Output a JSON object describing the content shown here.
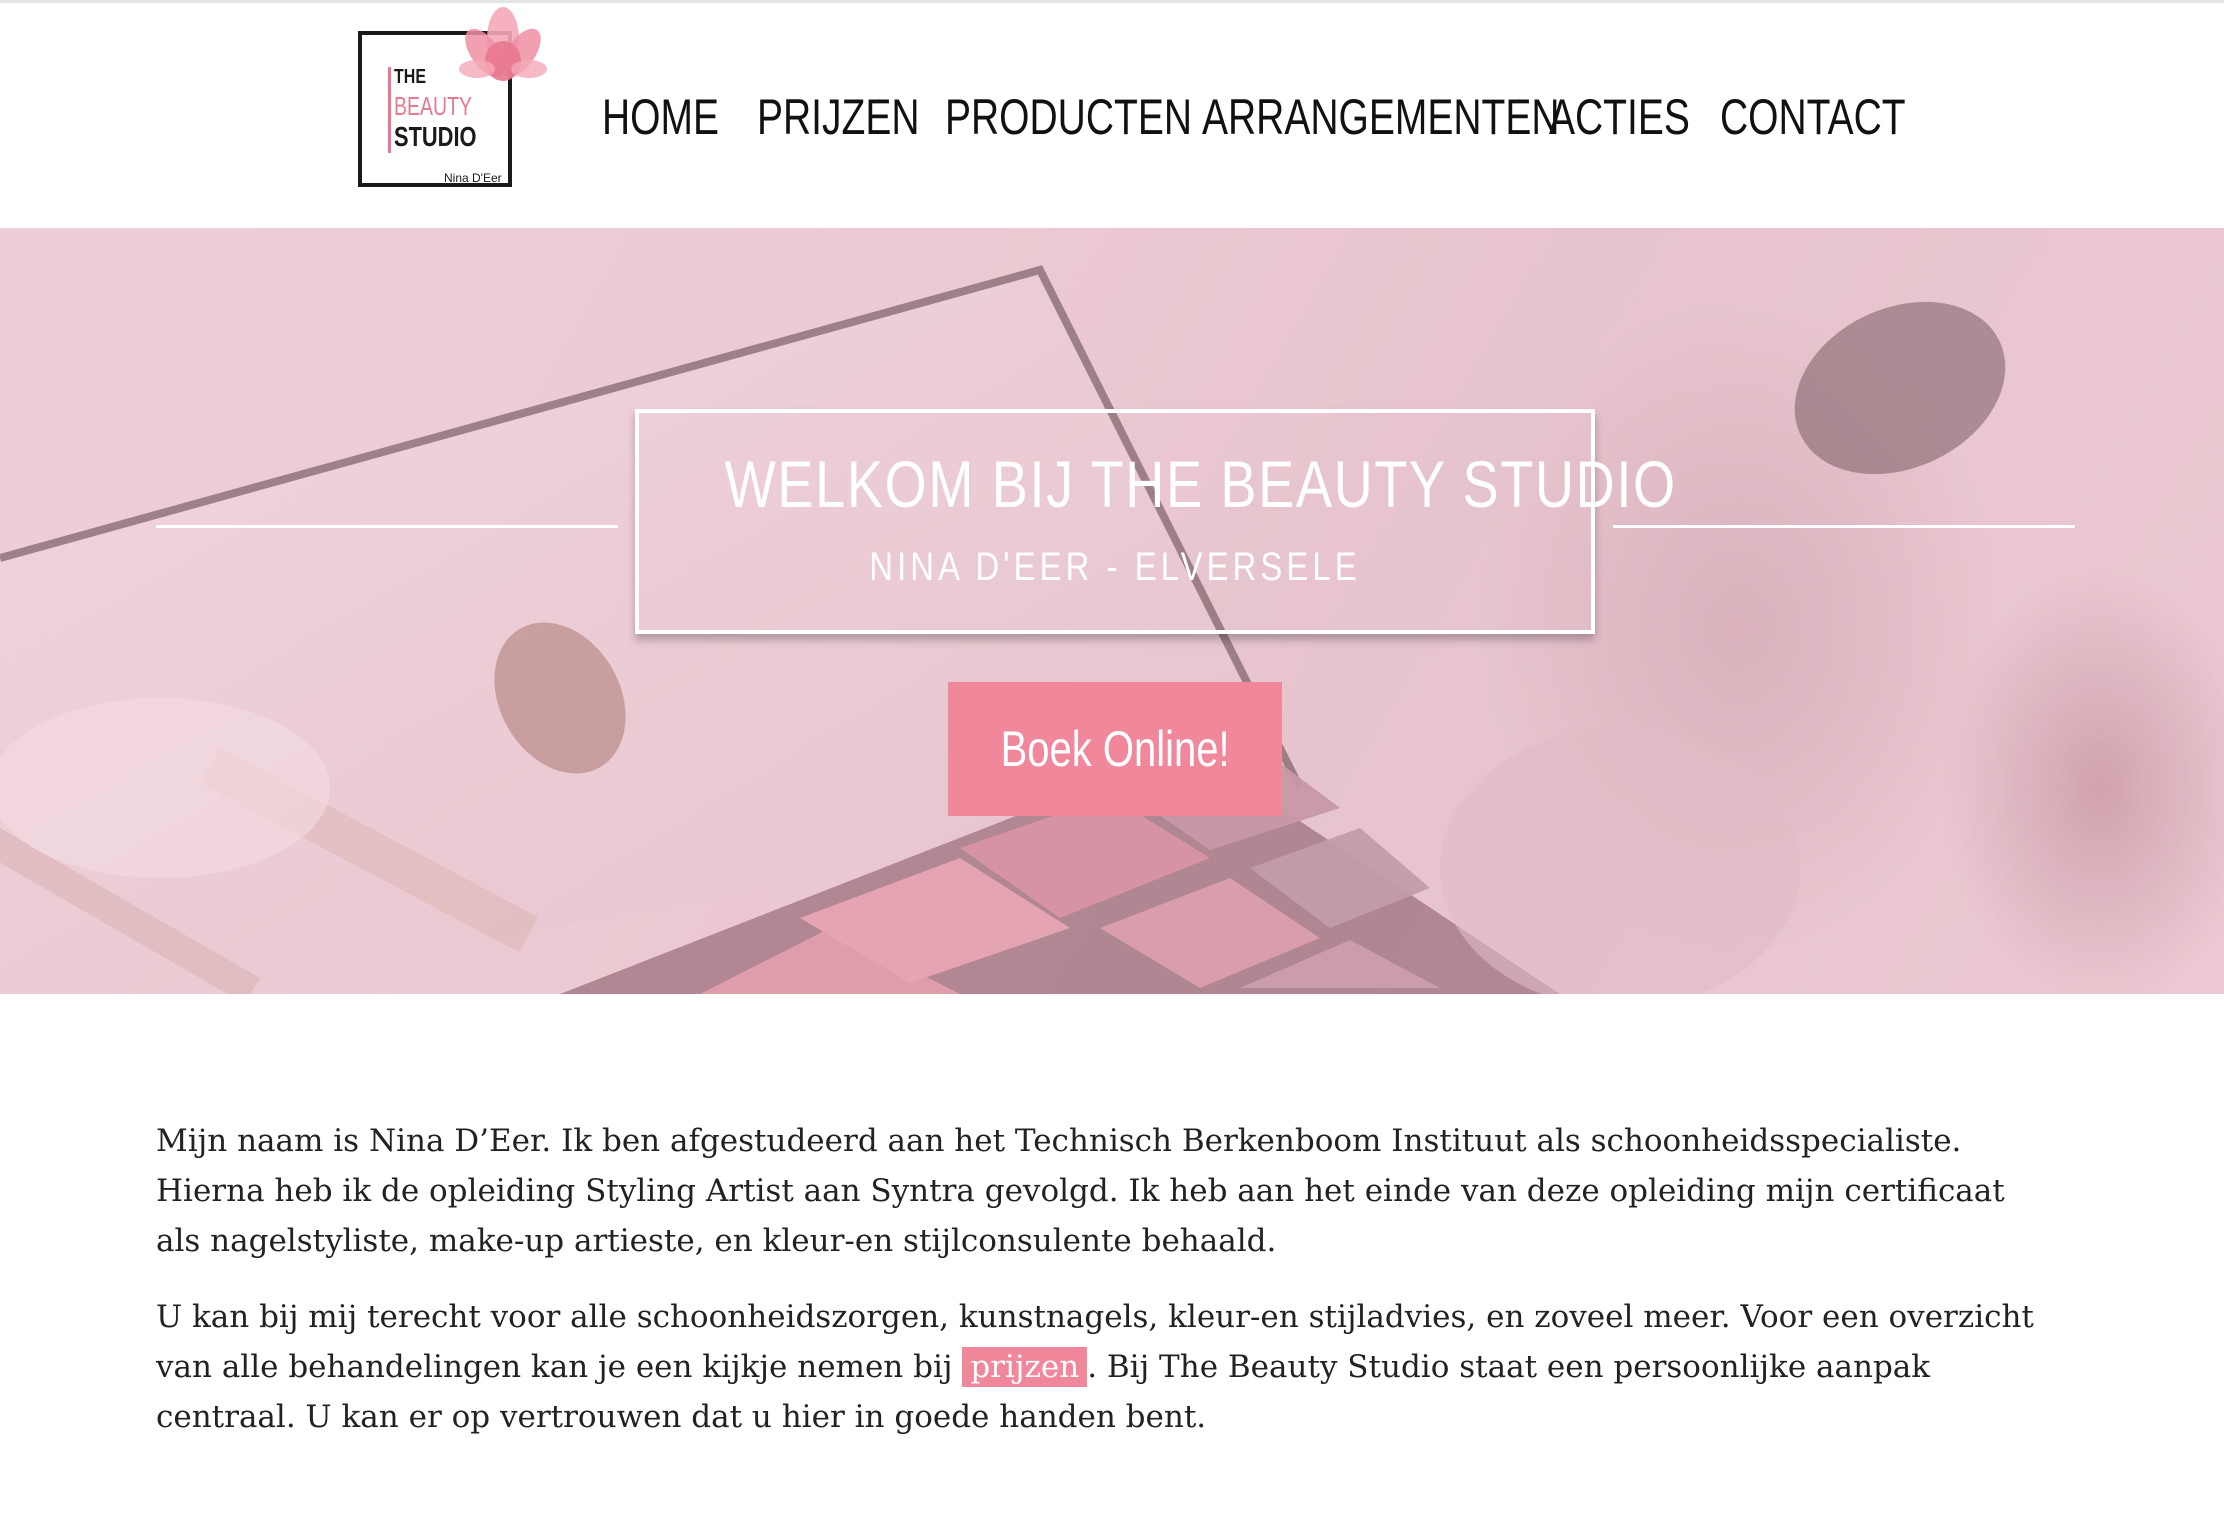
{
  "logo": {
    "line1": "THE",
    "line2": "BEAUTY",
    "line3": "STUDIO",
    "signature": "Nina D'Eer"
  },
  "nav": {
    "items": [
      {
        "label": "HOME"
      },
      {
        "label": "PRIJZEN"
      },
      {
        "label": "PRODUCTEN"
      },
      {
        "label": "ARRANGEMENTEN"
      },
      {
        "label": "ACTIES"
      },
      {
        "label": "CONTACT"
      }
    ]
  },
  "hero": {
    "title": "WELKOM BIJ THE BEAUTY STUDIO",
    "subtitle": "NINA D'EER - ELVERSELE",
    "cta_label": "Boek Online!"
  },
  "content": {
    "paragraph1": "Mijn naam is Nina D’Eer. Ik ben afgestudeerd aan het Technisch Berkenboom Instituut als schoonheidsspecialiste. Hierna heb ik de opleiding Styling Artist aan Syntra gevolgd. Ik heb aan het einde van deze opleiding mijn certificaat als nagelstyliste, make-up artieste, en kleur-en stijlconsulente behaald.",
    "paragraph2_before": "U kan bij mij terecht voor alle schoonheidszorgen, kunstnagels, kleur-en stijladvies, en zoveel meer. Voor een overzicht van alle behandelingen kan je een kijkje nemen bij ",
    "paragraph2_link": "prijzen",
    "paragraph2_after": ". Bij The Beauty Studio staat een persoonlijke aanpak centraal. U kan er op vertrouwen dat u hier in goede handen bent."
  },
  "colors": {
    "accent_pink": "#f0879b",
    "text_dark": "#111111",
    "hero_tint": "#e9cdd5"
  }
}
